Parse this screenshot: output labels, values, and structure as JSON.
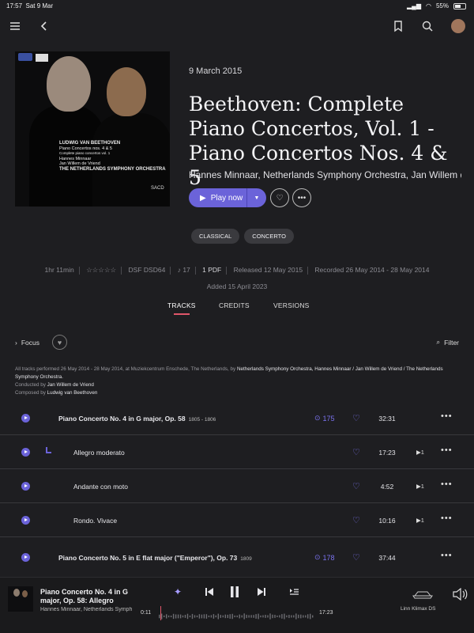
{
  "status_bar": {
    "time": "17:57",
    "date": "Sat 9 Mar",
    "battery": "55%"
  },
  "album": {
    "release_date": "9 March 2015",
    "title": "Beethoven: Complete Piano Concertos, Vol. 1 - Piano Concertos Nos. 4 & 5",
    "artists": "Hannes Minnaar, Netherlands Symphony Orchestra, Jan Willem de Vriend",
    "cover": {
      "composer": "LUDWIG VAN BEETHOVEN",
      "works": "Piano Concertos nos. 4 & 5",
      "series": "Complete piano concertos vol. 1",
      "performer1": "Hannes Minnaar",
      "performer2": "Jan Willem de Vriend",
      "orchestra": "THE NETHERLANDS SYMPHONY ORCHESTRA",
      "format_logo": "SACD"
    }
  },
  "actions": {
    "play_label": "Play now"
  },
  "tags": [
    "CLASSICAL",
    "CONCERTO"
  ],
  "meta": {
    "duration": "1hr 11min",
    "rating": "☆☆☆☆☆",
    "format": "DSF DSD64",
    "track_count": "17",
    "pdf": "1 PDF",
    "released": "Released 12 May 2015",
    "recorded": "Recorded 26 May 2014 - 28 May 2014",
    "added": "Added 15 April 2023"
  },
  "tabs": [
    {
      "label": "TRACKS",
      "active": true
    },
    {
      "label": "CREDITS",
      "active": false
    },
    {
      "label": "VERSIONS",
      "active": false
    }
  ],
  "toolbar": {
    "focus_label": "Focus",
    "filter_label": "Filter"
  },
  "notes": {
    "line1_prefix": "All tracks performed 26 May 2014 - 28 May 2014, at Muziekcentrum Enschede, The Netherlands, by ",
    "line1_performers": "Netherlands Symphony Orchestra, Hannes Minnaar / Jan Willem de Vriend / The Netherlands Symphony Orchestra.",
    "conducted_prefix": "Conducted by ",
    "conductor": "Jan Willem de Vriend",
    "composed_prefix": "Composed by ",
    "composer": "Ludwig van Beethoven"
  },
  "tracks": [
    {
      "name": "Piano Concerto No. 4 in G major, Op. 58",
      "years": "1805 - 1806",
      "count": "175",
      "duration": "32:31",
      "cue": "",
      "is_work": true
    },
    {
      "name": "Allegro moderato",
      "years": "",
      "count": "",
      "duration": "17:23",
      "cue": "▶1",
      "is_work": false
    },
    {
      "name": "Andante con moto",
      "years": "",
      "count": "",
      "duration": "4:52",
      "cue": "▶1",
      "is_work": false
    },
    {
      "name": "Rondo. Vivace",
      "years": "",
      "count": "",
      "duration": "10:16",
      "cue": "▶1",
      "is_work": false
    },
    {
      "name": "Piano Concerto No. 5 in E flat major (\"Emperor\"), Op. 73",
      "years": "1809",
      "count": "178",
      "duration": "37:44",
      "cue": "",
      "is_work": true
    }
  ],
  "now_playing": {
    "title": "Piano Concerto No. 4 in G major, Op. 58: Allegro",
    "artist": "Hannes Minnaar, Netherlands Symphony Orchestra, Jan Willem de Vriend",
    "elapsed": "0:11",
    "total": "17:23",
    "progress_fraction": 0.011,
    "device": "Linn Klimax DS"
  },
  "colors": {
    "accent": "#6b63d9",
    "accent_light": "#7a72ee",
    "playhead": "#e0566a",
    "background": "#1e1e21"
  }
}
